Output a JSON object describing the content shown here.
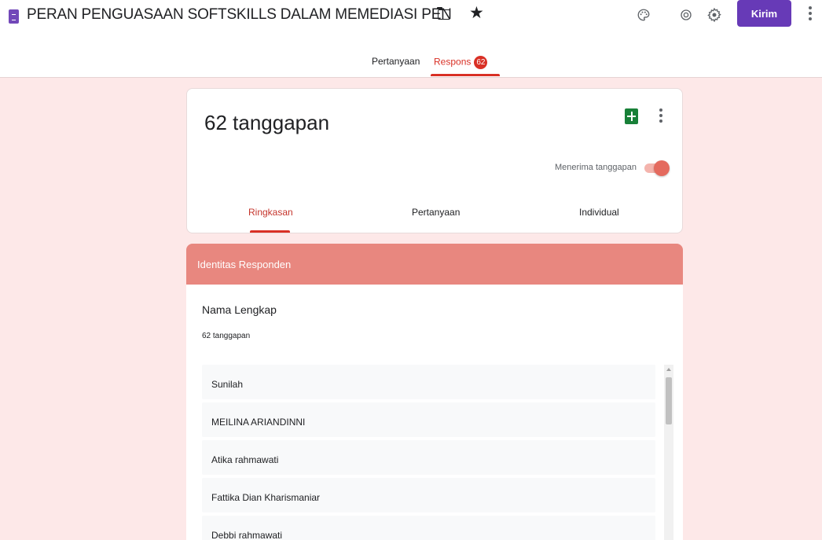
{
  "app": {
    "form_title": "PERAN PENGUASAAN SOFTSKILLS DALAM MEMEDIASI PEN",
    "send_label": "Kirim",
    "icons": [
      "form-doc-icon",
      "folder-icon",
      "star-icon",
      "palette-icon",
      "preview-eye-icon",
      "settings-gear-icon",
      "more-vert-icon"
    ]
  },
  "top_tabs": {
    "questions_label": "Pertanyaan",
    "responses_label": "Respons",
    "responses_badge": "62",
    "active": "responses"
  },
  "summary": {
    "response_count_label": "62 tanggapan",
    "accepting_label": "Menerima tanggapan",
    "accepting_responses": true,
    "tabs": [
      "Ringkasan",
      "Pertanyaan",
      "Individual"
    ],
    "active_tab": "Ringkasan"
  },
  "section": {
    "title": "Identitas Responden",
    "question": {
      "title": "Nama Lengkap",
      "count_label": "62 tanggapan",
      "answers": [
        "Sunilah",
        "MEILINA ARIANDINNI",
        "Atika rahmawati",
        "Fattika Dian Kharismaniar",
        "Debbi rahmawati"
      ]
    }
  },
  "colors": {
    "accent": "#d93025",
    "theme_header": "#e8877f",
    "page_background": "#fde8e8",
    "send_button": "#673ab7",
    "sheets_green": "#188038"
  }
}
